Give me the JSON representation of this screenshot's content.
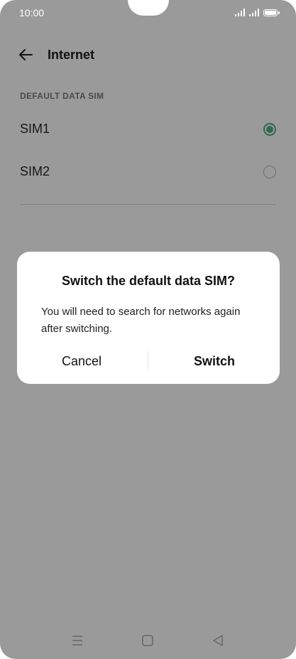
{
  "status_bar": {
    "time": "10:00"
  },
  "header": {
    "title": "Internet"
  },
  "section": {
    "label": "DEFAULT DATA SIM"
  },
  "sims": [
    {
      "label": "SIM1",
      "selected": true
    },
    {
      "label": "SIM2",
      "selected": false
    }
  ],
  "dialog": {
    "title": "Switch the default data SIM?",
    "message": "You will need to search for networks again after switching.",
    "cancel_label": "Cancel",
    "confirm_label": "Switch"
  },
  "colors": {
    "accent": "#2f6b4f",
    "scrim": "#9a9a9a",
    "dialog_bg": "#ffffff"
  },
  "icons": [
    "back-arrow-icon",
    "signal-icon",
    "battery-icon",
    "menu-icon",
    "home-icon",
    "back-triangle-icon"
  ]
}
